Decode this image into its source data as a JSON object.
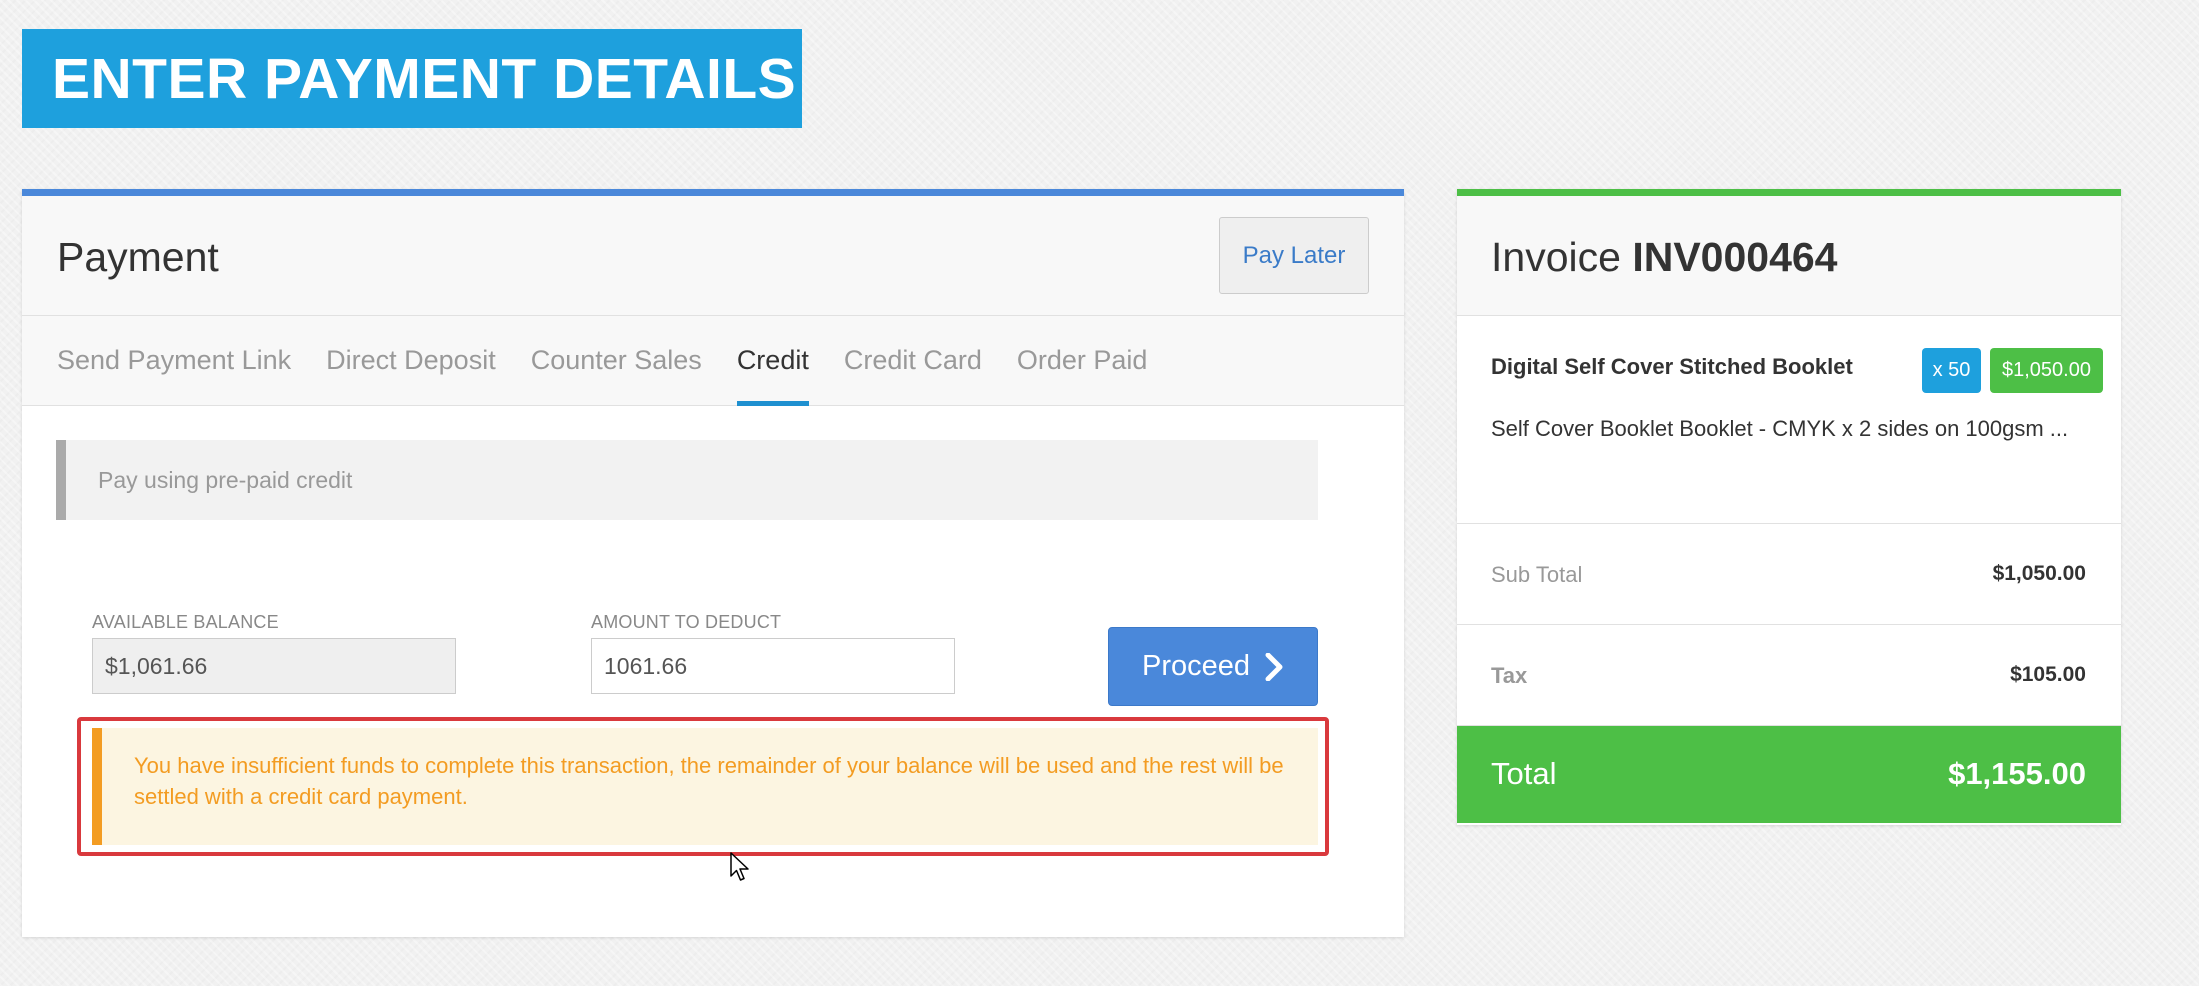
{
  "page": {
    "title": "ENTER PAYMENT DETAILS"
  },
  "payment": {
    "heading": "Payment",
    "pay_later_label": "Pay Later",
    "tabs": [
      {
        "label": "Send Payment Link",
        "active": false
      },
      {
        "label": "Direct Deposit",
        "active": false
      },
      {
        "label": "Counter Sales",
        "active": false
      },
      {
        "label": "Credit",
        "active": true
      },
      {
        "label": "Credit Card",
        "active": false
      },
      {
        "label": "Order Paid",
        "active": false
      }
    ],
    "credit_info": "Pay using pre-paid credit",
    "available_balance_label": "AVAILABLE BALANCE",
    "available_balance_value": "$1,061.66",
    "amount_to_deduct_label": "AMOUNT TO DEDUCT",
    "amount_to_deduct_value": "1061.66",
    "proceed_label": "Proceed",
    "alert_text": "You have insufficient funds to complete this transaction, the remainder of your balance will be used and the rest will be settled with a credit card payment."
  },
  "invoice": {
    "label": "Invoice",
    "number": "INV000464",
    "item": {
      "name": "Digital Self Cover Stitched Booklet",
      "quantity": "x 50",
      "price": "$1,050.00",
      "description": "Self Cover Booklet Booklet - CMYK x 2 sides on 100gsm ..."
    },
    "sub_total_label": "Sub Total",
    "sub_total_value": "$1,050.00",
    "tax_label": "Tax",
    "tax_value": "$105.00",
    "total_label": "Total",
    "total_value": "$1,155.00"
  },
  "colors": {
    "title_bg": "#1ea0dd",
    "payment_accent": "#4a88da",
    "invoice_accent": "#4dbf46",
    "warning": "#f39c22",
    "highlight_outline": "#d9393d"
  },
  "icons": {
    "proceed": "chevron-right-icon",
    "cursor": "mouse-pointer-icon"
  }
}
